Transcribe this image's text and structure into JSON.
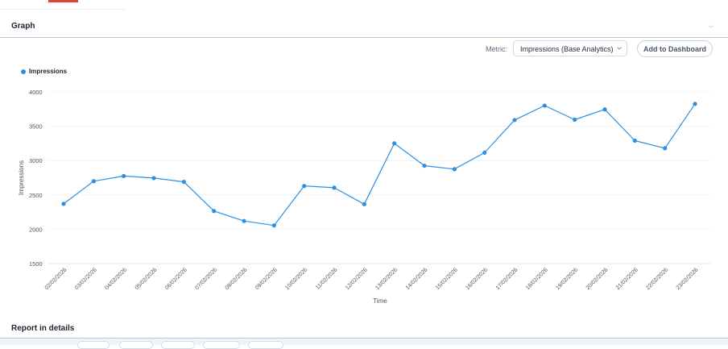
{
  "graph": {
    "title": "Graph"
  },
  "controls": {
    "metric_label": "Metric:",
    "metric_value": "Impressions (Base Analytics)",
    "add_button": "Add to Dashboard"
  },
  "legend": {
    "label": "Impressions",
    "color": "#2f8fdf"
  },
  "report": {
    "title": "Report in details"
  },
  "chart_data": {
    "type": "line",
    "xlabel": "Time",
    "ylabel": "Impressions",
    "ylim": [
      1500,
      4000
    ],
    "yticks": [
      1500,
      2000,
      2500,
      3000,
      3500,
      4000
    ],
    "grid": true,
    "legend_position": "top-left",
    "categories": [
      "02/02/2026",
      "03/02/2026",
      "04/02/2026",
      "05/02/2026",
      "06/02/2026",
      "07/02/2026",
      "08/02/2026",
      "09/02/2026",
      "10/02/2026",
      "11/02/2026",
      "12/02/2026",
      "13/02/2026",
      "14/02/2026",
      "15/02/2026",
      "16/02/2026",
      "17/02/2026",
      "18/02/2026",
      "19/02/2026",
      "20/02/2026",
      "21/02/2026",
      "22/02/2026",
      "23/02/2026"
    ],
    "series": [
      {
        "name": "Impressions",
        "color": "#2f8fdf",
        "values": [
          2370,
          2700,
          2775,
          2745,
          2690,
          2265,
          2120,
          2055,
          2630,
          2605,
          2365,
          3250,
          2925,
          2875,
          3115,
          3590,
          3800,
          3595,
          3745,
          3290,
          3180,
          3825
        ]
      }
    ]
  }
}
